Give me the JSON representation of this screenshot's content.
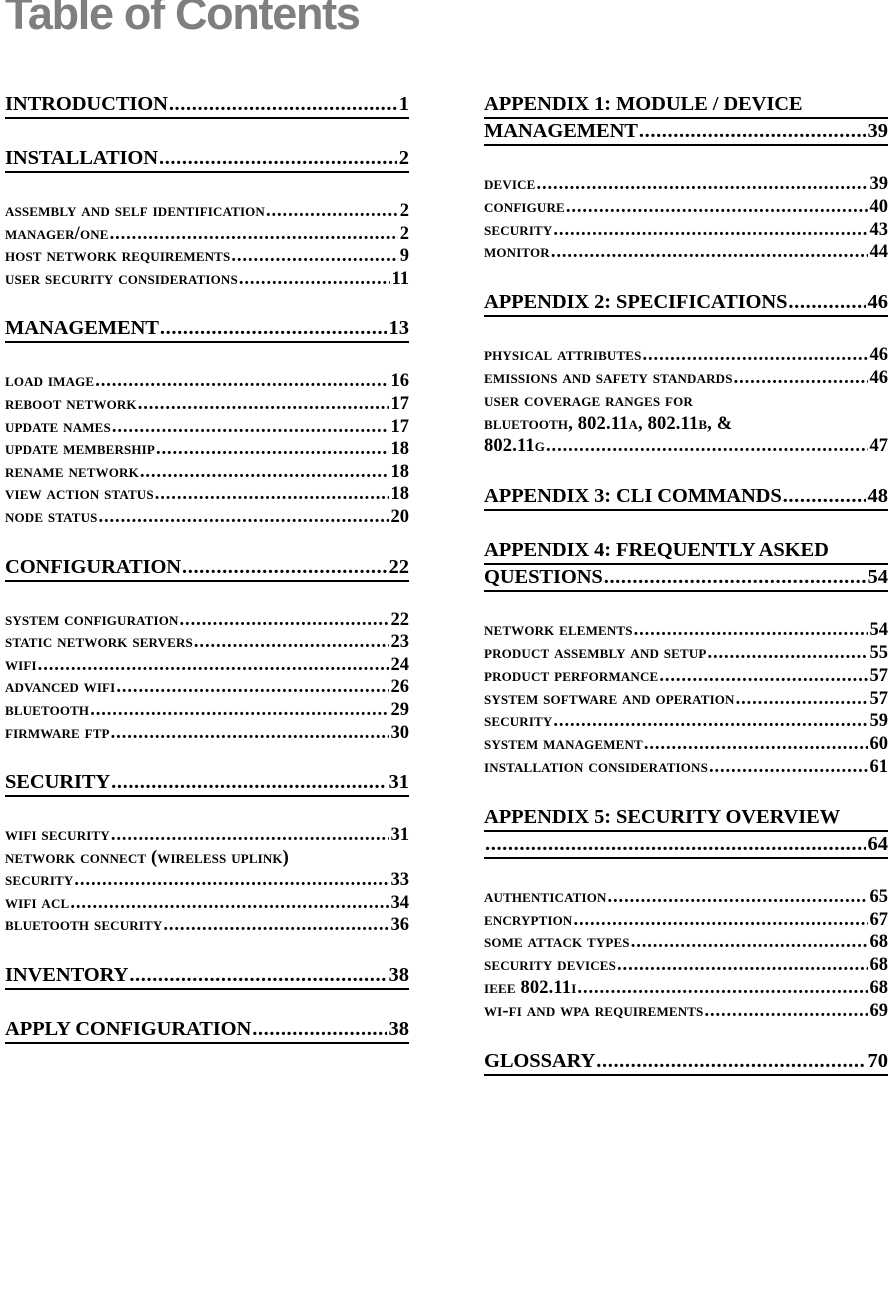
{
  "document": {
    "title": "Table of Contents"
  },
  "leaders": {
    "dots": "........................"
  },
  "columns": {
    "left": [
      {
        "type": "heading",
        "name": "introduction",
        "lines": [
          {
            "label": "INTRODUCTION",
            "page": "1"
          }
        ]
      },
      {
        "type": "heading",
        "name": "installation",
        "lines": [
          {
            "label": "INSTALLATION",
            "page": "2"
          }
        ]
      },
      {
        "type": "group",
        "name": "installation-subentries",
        "items": [
          {
            "label": "Assembly and Self Identification",
            "page": "2"
          },
          {
            "label": "Manager/one",
            "page": "2"
          },
          {
            "label": "Host Network Requirements",
            "page": "9"
          },
          {
            "label": "User Security Considerations",
            "page": "11"
          }
        ]
      },
      {
        "type": "heading",
        "name": "management",
        "lines": [
          {
            "label": "MANAGEMENT",
            "page": "13"
          }
        ]
      },
      {
        "type": "group",
        "name": "management-subentries",
        "items": [
          {
            "label": "Load Image",
            "page": "16"
          },
          {
            "label": "Reboot Network",
            "page": "17"
          },
          {
            "label": "Update Names",
            "page": "17"
          },
          {
            "label": "Update Membership",
            "page": "18"
          },
          {
            "label": "Rename Network",
            "page": "18"
          },
          {
            "label": "View Action Status",
            "page": "18"
          },
          {
            "label": "Node Status",
            "page": "20"
          }
        ]
      },
      {
        "type": "heading",
        "name": "configuration",
        "lines": [
          {
            "label": "CONFIGURATION",
            "page": "22"
          }
        ]
      },
      {
        "type": "group",
        "name": "configuration-subentries",
        "items": [
          {
            "label": "System Configuration",
            "page": "22"
          },
          {
            "label": "Static Network Servers",
            "page": "23"
          },
          {
            "label": "WiFi",
            "page": "24"
          },
          {
            "label": "Advanced WiFi",
            "page": "26"
          },
          {
            "label": "Bluetooth",
            "page": "29"
          },
          {
            "label": "Firmware Ftp",
            "page": "30"
          }
        ]
      },
      {
        "type": "heading",
        "name": "security",
        "lines": [
          {
            "label": "SECURITY",
            "page": "31"
          }
        ]
      },
      {
        "type": "group",
        "name": "security-subentries",
        "items": [
          {
            "label": "WiFi Security",
            "page": "31"
          },
          {
            "label": "Network Connect (wireless uplink)",
            "page": "",
            "nodots": true
          },
          {
            "label": "Security",
            "page": "33"
          },
          {
            "label": "WiFi ACL",
            "page": "34"
          },
          {
            "label": "Bluetooth Security",
            "page": "36"
          }
        ]
      },
      {
        "type": "heading",
        "name": "inventory",
        "lines": [
          {
            "label": "INVENTORY",
            "page": "38"
          }
        ]
      },
      {
        "type": "heading",
        "name": "apply-configuration",
        "lines": [
          {
            "label": "APPLY CONFIGURATION",
            "page": "38"
          }
        ]
      }
    ],
    "right": [
      {
        "type": "heading",
        "name": "appendix-1",
        "lines": [
          {
            "label": "APPENDIX 1: MODULE / DEVICE",
            "page": "",
            "nodots": true
          },
          {
            "label": "MANAGEMENT",
            "page": "39"
          }
        ]
      },
      {
        "type": "group",
        "name": "appendix-1-subentries",
        "items": [
          {
            "label": "Device",
            "page": "39"
          },
          {
            "label": "Configure",
            "page": "40"
          },
          {
            "label": "Security",
            "page": "43"
          },
          {
            "label": "Monitor",
            "page": "44"
          }
        ]
      },
      {
        "type": "heading",
        "name": "appendix-2",
        "lines": [
          {
            "label": "APPENDIX 2: SPECIFICATIONS",
            "page": "46"
          }
        ]
      },
      {
        "type": "group",
        "name": "appendix-2-subentries",
        "items": [
          {
            "label": "Physical Attributes",
            "page": "46"
          },
          {
            "label": "Emissions and Safety Standards",
            "page": "46"
          },
          {
            "label": "User Coverage Ranges for",
            "page": "",
            "nodots": true
          },
          {
            "label": "Bluetooth, 802.11a, 802.11b, &",
            "page": "",
            "nodots": true
          },
          {
            "label": "802.11g",
            "page": "47"
          }
        ]
      },
      {
        "type": "heading",
        "name": "appendix-3",
        "lines": [
          {
            "label": "APPENDIX 3: CLI COMMANDS",
            "page": "48"
          }
        ]
      },
      {
        "type": "heading",
        "name": "appendix-4",
        "lines": [
          {
            "label": "APPENDIX 4: FREQUENTLY ASKED",
            "page": "",
            "nodots": true
          },
          {
            "label": "QUESTIONS",
            "page": "54"
          }
        ]
      },
      {
        "type": "group",
        "name": "appendix-4-subentries",
        "items": [
          {
            "label": "Network Elements",
            "page": "54"
          },
          {
            "label": "Product Assembly and Setup",
            "page": "55"
          },
          {
            "label": "Product Performance",
            "page": "57"
          },
          {
            "label": "System Software and Operation",
            "page": "57"
          },
          {
            "label": "Security",
            "page": "59"
          },
          {
            "label": "System Management",
            "page": "60"
          },
          {
            "label": "Installation Considerations",
            "page": "61"
          }
        ]
      },
      {
        "type": "heading",
        "name": "appendix-5",
        "lines": [
          {
            "label": "APPENDIX 5: SECURITY OVERVIEW",
            "page": "",
            "nodots": true
          },
          {
            "label": "",
            "page": "64"
          }
        ]
      },
      {
        "type": "group",
        "name": "appendix-5-subentries",
        "items": [
          {
            "label": "Authentication",
            "page": "65"
          },
          {
            "label": "Encryption",
            "page": "67"
          },
          {
            "label": "Some Attack Types",
            "page": "68"
          },
          {
            "label": "Security Devices",
            "page": "68"
          },
          {
            "label": "IEEE 802.11i",
            "page": "68"
          },
          {
            "label": "Wi-Fi and WPA requirements",
            "page": "69"
          }
        ]
      },
      {
        "type": "heading",
        "name": "glossary",
        "lines": [
          {
            "label": "GLOSSARY",
            "page": "70"
          }
        ]
      }
    ]
  }
}
